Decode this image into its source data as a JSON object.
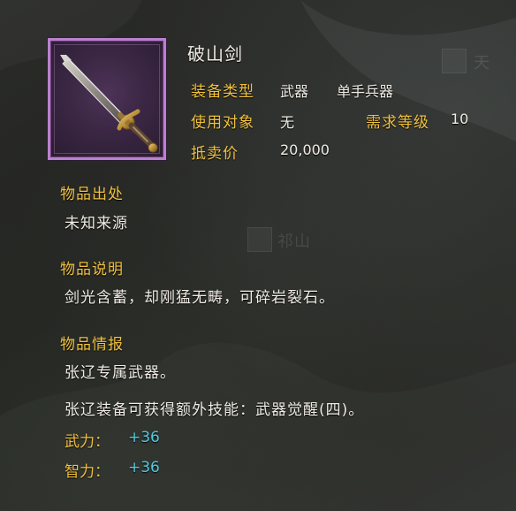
{
  "item": {
    "name": "破山剑",
    "fields": {
      "equip_type_label": "装备类型",
      "equip_type_value": "武器",
      "weapon_class_value": "单手兵器",
      "user_label": "使用对象",
      "user_value": "无",
      "level_label": "需求等级",
      "level_value": "10",
      "price_label": "抵卖价",
      "price_value": "20,000"
    },
    "sections": {
      "origin_title": "物品出处",
      "origin_text": "未知来源",
      "description_title": "物品说明",
      "description_text": "剑光含蓄，却刚猛无畴，可碎岩裂石。",
      "info_title": "物品情报",
      "info_line1": "张辽专属武器。",
      "info_line2": "张辽装备可获得额外技能：武器觉醒(四)。"
    },
    "stats": {
      "force_label": "武力：",
      "force_value": "+36",
      "intellect_label": "智力：",
      "intellect_value": "+36"
    }
  },
  "background": {
    "map_label_mid": "祁山",
    "map_label_right": "天"
  },
  "colors": {
    "label": "#f0c13f",
    "value": "#f0ece4",
    "stat": "#53c9de",
    "frame": "#bc7fd1"
  },
  "icons": {
    "item": "sword-icon",
    "map_badge": "seal-icon"
  }
}
